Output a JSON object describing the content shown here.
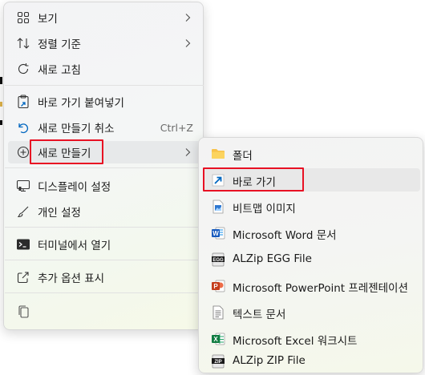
{
  "context_menu": {
    "items": [
      {
        "label": "보기",
        "icon": "grid-view-icon",
        "has_submenu": true
      },
      {
        "label": "정렬 기준",
        "icon": "sort-icon",
        "has_submenu": true
      },
      {
        "label": "새로 고침",
        "icon": "refresh-icon"
      },
      {
        "label": "바로 가기 붙여넣기",
        "icon": "paste-shortcut-icon"
      },
      {
        "label": "새로 만들기 취소",
        "icon": "undo-icon",
        "shortcut": "Ctrl+Z"
      },
      {
        "label": "새로 만들기",
        "icon": "add-circle-icon",
        "has_submenu": true
      },
      {
        "label": "디스플레이 설정",
        "icon": "display-icon"
      },
      {
        "label": "개인 설정",
        "icon": "brush-icon"
      },
      {
        "label": "터미널에서 열기",
        "icon": "terminal-icon"
      },
      {
        "label": "추가 옵션 표시",
        "icon": "share-icon"
      }
    ],
    "bottom_icon": "copy-icon"
  },
  "new_submenu": {
    "items": [
      {
        "label": "폴더",
        "icon": "folder-icon"
      },
      {
        "label": "바로 가기",
        "icon": "shortcut-icon"
      },
      {
        "label": "비트맵 이미지",
        "icon": "bitmap-icon"
      },
      {
        "label": "Microsoft Word 문서",
        "icon": "word-icon"
      },
      {
        "label": "ALZip EGG File",
        "icon": "egg-file-icon"
      },
      {
        "label": "Microsoft PowerPoint 프레젠테이션",
        "icon": "powerpoint-icon"
      },
      {
        "label": "텍스트 문서",
        "icon": "text-document-icon"
      },
      {
        "label": "Microsoft Excel 워크시트",
        "icon": "excel-icon"
      },
      {
        "label": "ALZip ZIP File",
        "icon": "zip-file-icon"
      }
    ],
    "egg_badge": "EGG",
    "zip_badge": "ZIP"
  },
  "colors": {
    "highlight": "#e81123",
    "accent": "#0067c0",
    "word": "#185abd",
    "powerpoint": "#c43e1c",
    "excel": "#107c41",
    "folder": "#f8c24a"
  }
}
